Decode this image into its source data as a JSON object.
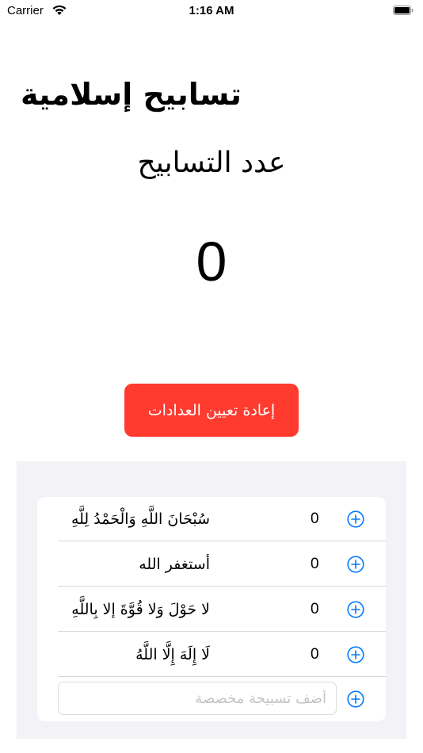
{
  "status_bar": {
    "carrier": "Carrier",
    "time": "1:16 AM"
  },
  "header": {
    "title": "تسابيح إسلامية"
  },
  "counter": {
    "label": "عدد التسابيح",
    "value": "0"
  },
  "reset": {
    "label": "إعادة تعيين العدادات",
    "color": "#ff3b30"
  },
  "tasbeeh_list": {
    "items": [
      {
        "label": "سُبْحَانَ اللَّهِ وَالْحَمْدُ لِلَّهِ",
        "count": "0"
      },
      {
        "label": "أستغفر الله",
        "count": "0"
      },
      {
        "label": "لا حَوْلَ وَلا قُوَّةَ إلا بِاللَّهِ",
        "count": "0"
      },
      {
        "label": "لَا إِلَهَ إِلَّا اللَّهُ",
        "count": "0"
      }
    ],
    "custom_input": {
      "placeholder": "أضف تسبيحة مخصصة",
      "value": ""
    }
  },
  "icons": {
    "add": "plus-circle-icon",
    "wifi": "wifi-icon",
    "battery": "battery-icon"
  },
  "colors": {
    "accent": "#007aff",
    "list_background": "#f2f2f7"
  }
}
